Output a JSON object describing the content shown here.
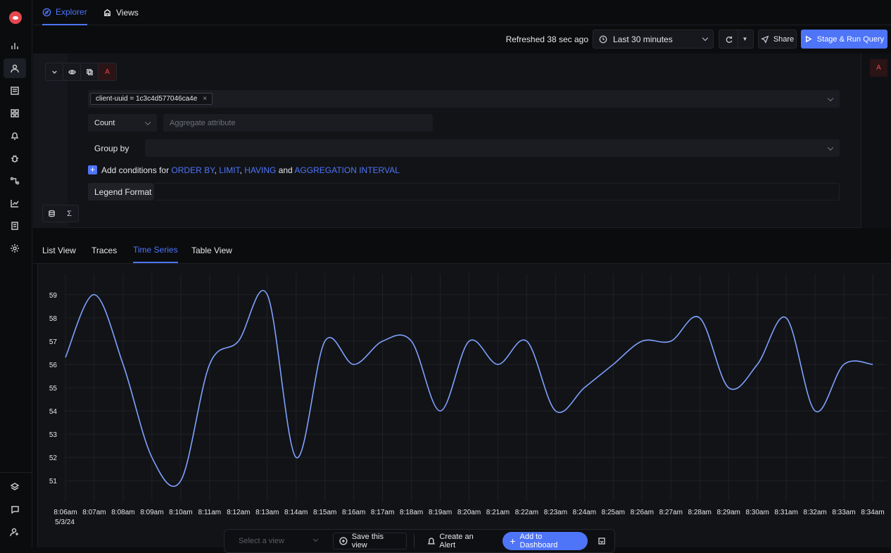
{
  "nav": {
    "tabs": [
      {
        "label": "Explorer",
        "icon": "compass-icon",
        "active": true
      },
      {
        "label": "Views",
        "icon": "views-icon",
        "active": false
      }
    ]
  },
  "sidebar": {
    "items": [
      "bar-chart-icon",
      "user-icon",
      "list-icon",
      "grid-icon",
      "bell-icon",
      "bug-icon",
      "flow-icon",
      "line-chart-icon",
      "doc-icon",
      "gear-icon"
    ],
    "bottom_items": [
      "layers-icon",
      "message-icon",
      "user-plus-icon"
    ]
  },
  "toolbar": {
    "refreshed": "Refreshed 38 sec ago",
    "time_range": "Last 30 minutes",
    "share_label": "Share",
    "run_label": "Stage & Run Query"
  },
  "query": {
    "letter": "A",
    "filter_chip": "client-uuid = 1c3c4d577046ca4e",
    "aggregate_op": "Count",
    "aggregate_placeholder": "Aggregate attribute",
    "group_by_label": "Group by",
    "conditions_prefix": "Add conditions for",
    "conditions_links": [
      "ORDER BY",
      "LIMIT",
      "HAVING",
      "AGGREGATION INTERVAL"
    ],
    "conditions_and": "and",
    "legend_label": "Legend Format"
  },
  "view_tabs": [
    {
      "label": "List View",
      "active": false
    },
    {
      "label": "Traces",
      "active": false
    },
    {
      "label": "Time Series",
      "active": true
    },
    {
      "label": "Table View",
      "active": false
    }
  ],
  "chart_data": {
    "type": "line",
    "x": [
      "8:06am",
      "8:07am",
      "8:08am",
      "8:09am",
      "8:10am",
      "8:11am",
      "8:12am",
      "8:13am",
      "8:14am",
      "8:15am",
      "8:16am",
      "8:17am",
      "8:18am",
      "8:19am",
      "8:20am",
      "8:21am",
      "8:22am",
      "8:23am",
      "8:24am",
      "8:25am",
      "8:26am",
      "8:27am",
      "8:28am",
      "8:29am",
      "8:30am",
      "8:31am",
      "8:32am",
      "8:33am",
      "8:34am"
    ],
    "x_sub_label": "5/3/24",
    "y_ticks": [
      51,
      52,
      53,
      54,
      55,
      56,
      57,
      58,
      59
    ],
    "ylim": [
      50.1,
      59.9
    ],
    "series": [
      {
        "values": [
          56.3,
          59,
          56,
          52,
          51,
          56,
          57,
          59,
          52,
          57,
          56,
          57,
          57,
          54,
          57,
          56,
          57,
          54,
          55,
          56,
          57,
          57,
          58,
          55,
          56,
          58,
          54,
          56,
          56
        ],
        "color": "#7ea2ff"
      }
    ],
    "grid": true
  },
  "bottom": {
    "select_placeholder": "Select a view",
    "save_label": "Save this view",
    "alert_label": "Create an Alert",
    "dashboard_label": "Add to Dashboard"
  }
}
